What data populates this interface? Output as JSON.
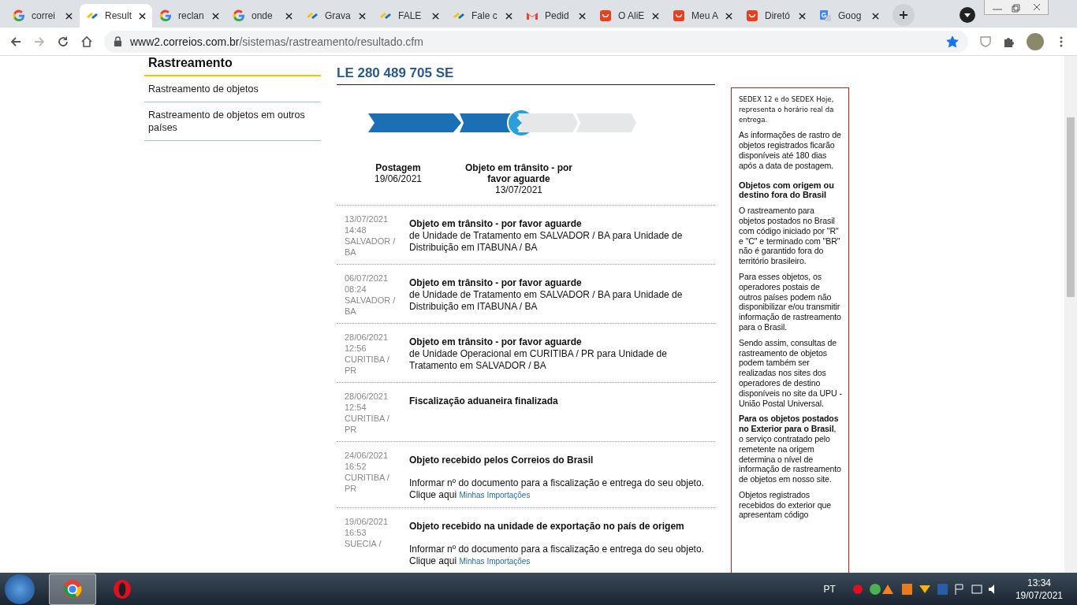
{
  "browser": {
    "tabs": [
      {
        "title": "correi",
        "kind": "google",
        "selected": false
      },
      {
        "title": "Result",
        "kind": "correios",
        "selected": true
      },
      {
        "title": "reclan",
        "kind": "google",
        "selected": false
      },
      {
        "title": "onde",
        "kind": "google",
        "selected": false
      },
      {
        "title": "Grava",
        "kind": "correios",
        "selected": false
      },
      {
        "title": "FALE",
        "kind": "correios",
        "selected": false
      },
      {
        "title": "Fale c",
        "kind": "correios",
        "selected": false
      },
      {
        "title": "Pedid",
        "kind": "gmail",
        "selected": false
      },
      {
        "title": "O AliE",
        "kind": "shop",
        "selected": false
      },
      {
        "title": "Meu A",
        "kind": "shop",
        "selected": false
      },
      {
        "title": "Diretó",
        "kind": "shop",
        "selected": false
      },
      {
        "title": "Goog",
        "kind": "translate",
        "selected": false
      }
    ],
    "url": {
      "host": "www2.correios.com.br",
      "path": "/sistemas/rastreamento/resultado.cfm"
    },
    "bookmarked": true
  },
  "sidebar": {
    "title": "Rastreamento",
    "items": [
      "Rastreamento de objetos",
      "Rastreamento de objetos em outros países"
    ]
  },
  "tracking": {
    "code": "LE 280 489 705 SE",
    "segments": [
      {
        "filled": true,
        "current": false
      },
      {
        "filled": true,
        "current": true
      },
      {
        "filled": false,
        "current": false
      },
      {
        "filled": false,
        "current": false
      }
    ],
    "milestones": [
      {
        "label": "Postagem",
        "date": "19/06/2021"
      },
      {
        "label": "Objeto em trânsito - por favor aguarde",
        "date": "13/07/2021"
      }
    ],
    "events": [
      {
        "date": "13/07/2021",
        "time": "14:48",
        "place": "SALVADOR / BA",
        "title": "Objeto em trânsito - por favor aguarde",
        "detail": "de Unidade de Tratamento em SALVADOR / BA para Unidade de Distribuição em ITABUNA / BA"
      },
      {
        "date": "06/07/2021",
        "time": "08:24",
        "place": "SALVADOR / BA",
        "title": "Objeto em trânsito - por favor aguarde",
        "detail": "de Unidade de Tratamento em SALVADOR / BA para Unidade de Distribuição em ITABUNA / BA"
      },
      {
        "date": "28/06/2021",
        "time": "12:56",
        "place": "CURITIBA / PR",
        "title": "Objeto em trânsito - por favor aguarde",
        "detail": "de Unidade Operacional em CURITIBA / PR para Unidade de Tratamento em SALVADOR / BA"
      },
      {
        "date": "28/06/2021",
        "time": "12:54",
        "place": "CURITIBA / PR",
        "title": "Fiscalização aduaneira finalizada"
      },
      {
        "date": "24/06/2021",
        "time": "16:52",
        "place": "CURITIBA / PR",
        "title": "Objeto recebido pelos Correios do Brasil",
        "note": "Informar nº do documento para a fiscalização e entrega do seu objeto. Clique aqui",
        "link": "Minhas Importações"
      },
      {
        "date": "19/06/2021",
        "time": "16:53",
        "place": "SUECIA /",
        "title": "Objeto recebido na unidade de exportação no país de origem",
        "note": "Informar nº do documento para a fiscalização e entrega do seu objeto. Clique aqui",
        "link": "Minhas Importações"
      }
    ]
  },
  "info_box": [
    {
      "kind": "small",
      "text": "SEDEX 12 e do SEDEX Hoje, representa o horário real da entrega."
    },
    {
      "kind": "text",
      "text": "As informações de rastro de objetos registrados ficarão disponíveis até 180 dias após a data de postagem."
    },
    {
      "kind": "heading",
      "text": "Objetos com origem ou destino fora do Brasil"
    },
    {
      "kind": "text",
      "text": "O rastreamento para objetos postados no Brasil com código iniciado por \"R\" e \"C\" e terminado com \"BR\" não é garantido fora do território brasileiro."
    },
    {
      "kind": "text",
      "text": "Para esses objetos, os operadores postais de outros países podem não disponibilizar e/ou transmitir informação de rastreamento para o Brasil."
    },
    {
      "kind": "text",
      "text": "Sendo assim, consultas de rastreamento de objetos podem também ser realizadas nos sites dos operadores de destino disponíveis no site da UPU - União Postal Universal."
    },
    {
      "kind": "text",
      "text": "**Para os objetos postados no Exterior para o Brasil**, o serviço contratado pelo remetente na origem determina o nível de informação de rastreamento de objetos em nosso site."
    },
    {
      "kind": "text",
      "text": "Objetos registrados recebidos do exterior que apresentam código"
    }
  ],
  "taskbar": {
    "language": "PT",
    "time": "13:34",
    "date": "19/07/2021"
  }
}
